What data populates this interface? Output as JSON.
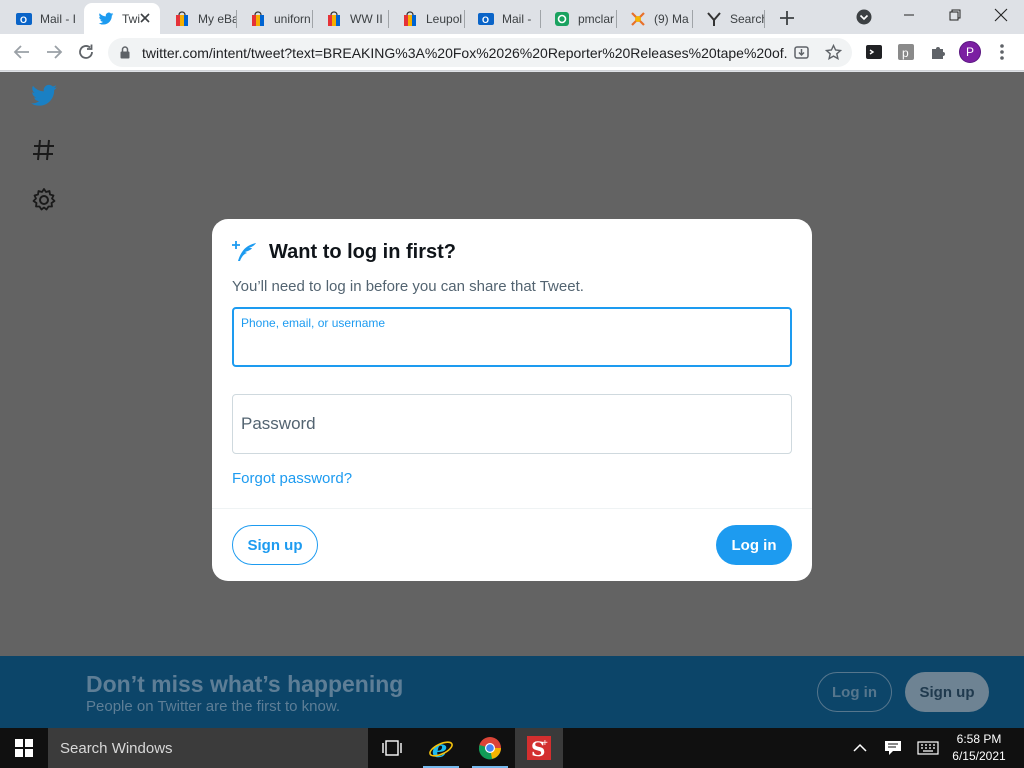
{
  "browser": {
    "tabs": [
      {
        "title": "Mail - I",
        "icon": "outlook-icon",
        "active": false
      },
      {
        "title": "Twi",
        "icon": "twitter-icon",
        "active": true
      },
      {
        "title": "My eBa",
        "icon": "ebay-icon",
        "active": false
      },
      {
        "title": "uniforn",
        "icon": "ebay-icon",
        "active": false
      },
      {
        "title": "WW II",
        "icon": "ebay-icon",
        "active": false
      },
      {
        "title": "Leupol",
        "icon": "ebay-icon",
        "active": false
      },
      {
        "title": "Mail -",
        "icon": "outlook-icon",
        "active": false
      },
      {
        "title": "pmclar",
        "icon": "green-app-icon",
        "active": false
      },
      {
        "title": "(9) Ma",
        "icon": "orange-app-icon",
        "active": false
      },
      {
        "title": "Search",
        "icon": "yahoo-icon",
        "active": false
      }
    ],
    "url": "twitter.com/intent/tweet?text=BREAKING%3A%20Fox%2026%20Reporter%20Releases%20tape%20of...",
    "profile_initial": "P"
  },
  "modal": {
    "title": "Want to log in first?",
    "subtitle": "You’ll need to log in before you can share that Tweet.",
    "username_label": "Phone, email, or username",
    "password_label": "Password",
    "forgot_link": "Forgot password?",
    "signup_button": "Sign up",
    "login_button": "Log in"
  },
  "bottom_bar": {
    "heading": "Don’t miss what’s happening",
    "subtext": "People on Twitter are the first to know.",
    "login_button": "Log in",
    "signup_button": "Sign up"
  },
  "taskbar": {
    "search_text": "Search Windows",
    "time": "6:58 PM",
    "date": "6/15/2021"
  },
  "colors": {
    "twitter_blue": "#1d9bf0",
    "overlay": "#636363",
    "bottom_bar": "#0c4569"
  }
}
